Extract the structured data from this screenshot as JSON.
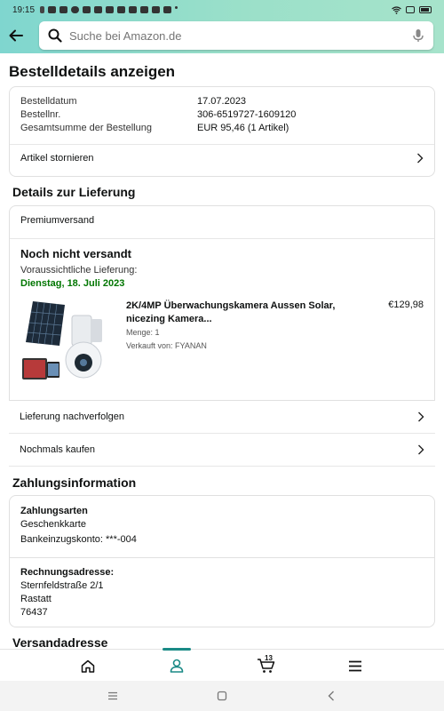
{
  "status": {
    "time": "19:15"
  },
  "search": {
    "placeholder": "Suche bei Amazon.de"
  },
  "page": {
    "title": "Bestelldetails anzeigen"
  },
  "summary": {
    "rows": [
      {
        "label": "Bestelldatum",
        "value": "17.07.2023"
      },
      {
        "label": "Bestellnr.",
        "value": "306-6519727-1609120"
      },
      {
        "label": "Gesamtsumme der Bestellung",
        "value": "EUR 95,46 (1 Artikel)"
      }
    ],
    "cancel_label": "Artikel stornieren"
  },
  "delivery": {
    "section_title": "Details zur Lieferung",
    "shipping_type": "Premiumversand",
    "status": "Noch nicht versandt",
    "expected_label": "Voraussichtliche Lieferung:",
    "expected_date": "Dienstag, 18. Juli 2023",
    "item": {
      "title": "2K/4MP Überwachungskamera Aussen Solar, nicezing Kamera...",
      "price": "€129,98",
      "quantity": "Menge: 1",
      "seller": "Verkauft von: FYANAN"
    },
    "track_label": "Lieferung nachverfolgen",
    "buy_again_label": "Nochmals kaufen"
  },
  "payment": {
    "section_title": "Zahlungsinformation",
    "methods_heading": "Zahlungsarten",
    "method1": "Geschenkkarte",
    "method2": "Bankeinzugskonto: ***-004",
    "billing_heading": "Rechnungsadresse:",
    "address_line1": "Sternfeldstraße 2/1",
    "address_line2": "Rastatt",
    "address_line3": "76437"
  },
  "shipping_address": {
    "section_title": "Versandadresse"
  },
  "bottom_nav": {
    "cart_count": "13",
    "active": "account"
  },
  "colors": {
    "accent": "#1a8a86",
    "delivery_green": "#007600",
    "header_start": "#7fd6cf",
    "header_end": "#a6e3cb"
  }
}
